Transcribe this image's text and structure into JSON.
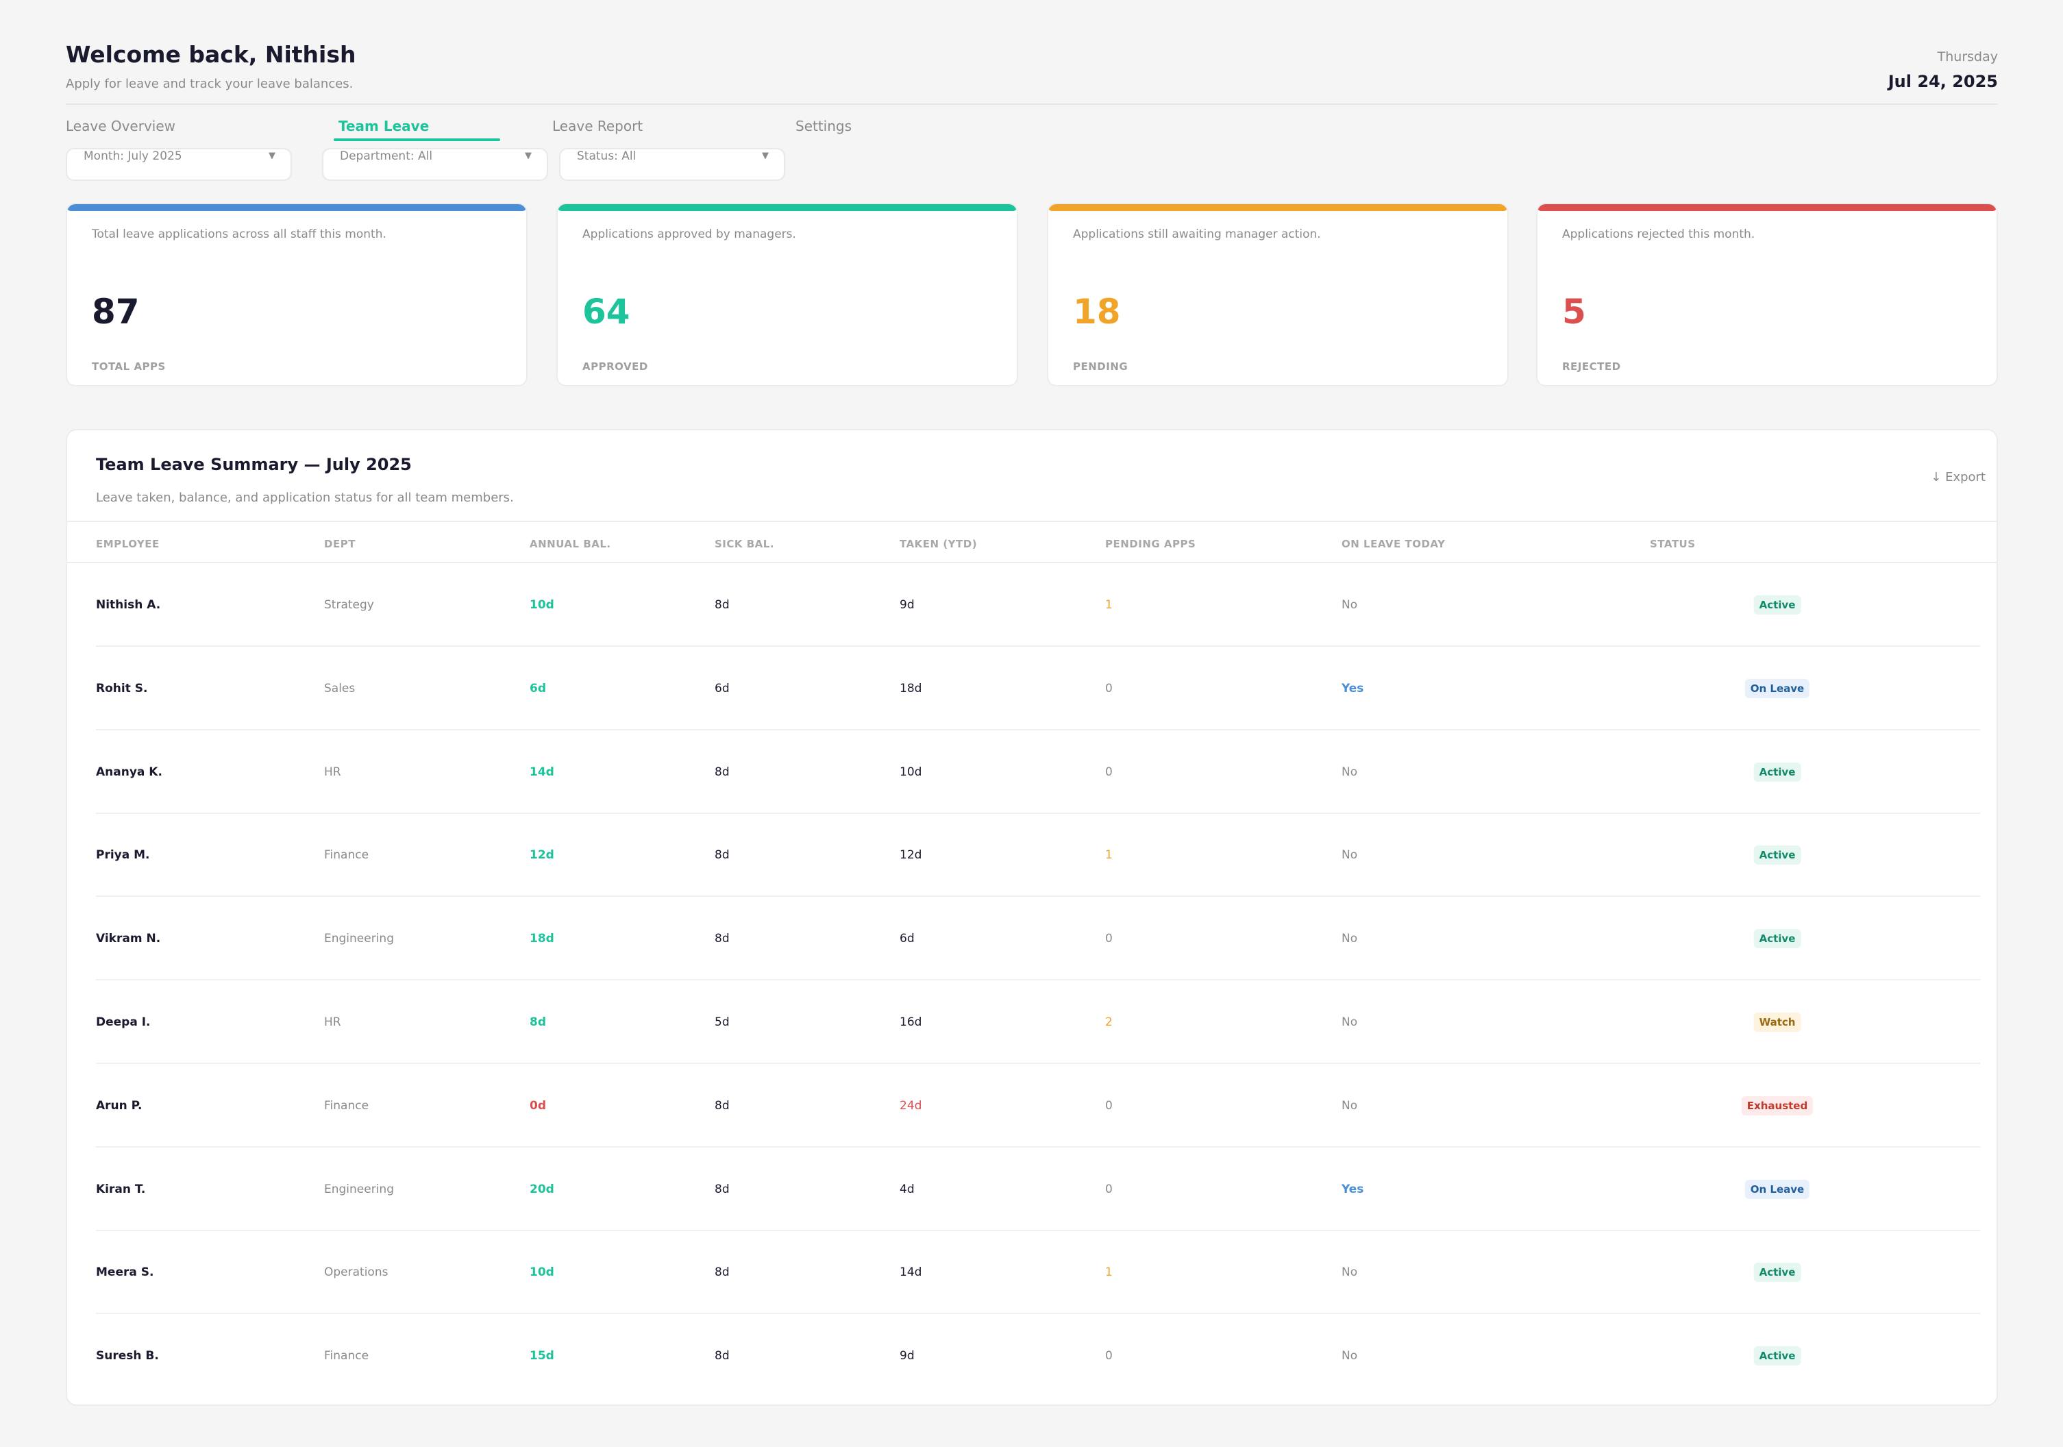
{
  "header": {
    "welcome": "Welcome back, Nithish",
    "subtitle": "Apply for leave and track your leave balances.",
    "day": "Thursday",
    "date": "Jul 24, 2025"
  },
  "tabs": [
    {
      "label": "Leave Overview",
      "active": false
    },
    {
      "label": "Team Leave",
      "active": true
    },
    {
      "label": "Leave Report",
      "active": false
    },
    {
      "label": "Settings",
      "active": false
    }
  ],
  "filters": [
    {
      "label": "Month: July 2025"
    },
    {
      "label": "Department: All"
    },
    {
      "label": "Status: All"
    }
  ],
  "cards": [
    {
      "desc": "Total leave applications across all staff this month.",
      "value": "87",
      "label": "TOTAL APPS",
      "color": "#4a8fd6"
    },
    {
      "desc": "Applications approved by managers.",
      "value": "64",
      "label": "APPROVED",
      "color": "#1dc39b"
    },
    {
      "desc": "Applications still awaiting manager action.",
      "value": "18",
      "label": "PENDING",
      "color": "#f0a52a"
    },
    {
      "desc": "Applications rejected this month.",
      "value": "5",
      "label": "REJECTED",
      "color": "#dc4f4f"
    }
  ],
  "table": {
    "title": "Team Leave Summary — July 2025",
    "subtitle": "Leave taken, balance, and application status for all team members.",
    "export_label": "↓ Export",
    "columns": [
      "EMPLOYEE",
      "DEPT",
      "ANNUAL BAL.",
      "SICK BAL.",
      "TAKEN (YTD)",
      "PENDING APPS",
      "ON LEAVE TODAY",
      "STATUS"
    ],
    "rows": [
      {
        "employee": "Nithish A.",
        "dept": "Strategy",
        "annual": "10d",
        "sick": "8d",
        "taken": "9d",
        "pending": "1",
        "on_leave": "No",
        "status": "Active"
      },
      {
        "employee": "Rohit S.",
        "dept": "Sales",
        "annual": "6d",
        "sick": "6d",
        "taken": "18d",
        "pending": "0",
        "on_leave": "Yes",
        "status": "On Leave"
      },
      {
        "employee": "Ananya K.",
        "dept": "HR",
        "annual": "14d",
        "sick": "8d",
        "taken": "10d",
        "pending": "0",
        "on_leave": "No",
        "status": "Active"
      },
      {
        "employee": "Priya M.",
        "dept": "Finance",
        "annual": "12d",
        "sick": "8d",
        "taken": "12d",
        "pending": "1",
        "on_leave": "No",
        "status": "Active"
      },
      {
        "employee": "Vikram N.",
        "dept": "Engineering",
        "annual": "18d",
        "sick": "8d",
        "taken": "6d",
        "pending": "0",
        "on_leave": "No",
        "status": "Active"
      },
      {
        "employee": "Deepa I.",
        "dept": "HR",
        "annual": "8d",
        "sick": "5d",
        "taken": "16d",
        "pending": "2",
        "on_leave": "No",
        "status": "Watch"
      },
      {
        "employee": "Arun P.",
        "dept": "Finance",
        "annual": "0d",
        "sick": "8d",
        "taken": "24d",
        "pending": "0",
        "on_leave": "No",
        "status": "Exhausted"
      },
      {
        "employee": "Kiran T.",
        "dept": "Engineering",
        "annual": "20d",
        "sick": "8d",
        "taken": "4d",
        "pending": "0",
        "on_leave": "Yes",
        "status": "On Leave"
      },
      {
        "employee": "Meera S.",
        "dept": "Operations",
        "annual": "10d",
        "sick": "8d",
        "taken": "14d",
        "pending": "1",
        "on_leave": "No",
        "status": "Active"
      },
      {
        "employee": "Suresh B.",
        "dept": "Finance",
        "annual": "15d",
        "sick": "8d",
        "taken": "9d",
        "pending": "0",
        "on_leave": "No",
        "status": "Active"
      }
    ]
  },
  "colors": {
    "accent": "#1dc39b",
    "pending_amber": "#f0a52a",
    "danger": "#dc4f4f",
    "link_blue": "#4a8fd6"
  }
}
